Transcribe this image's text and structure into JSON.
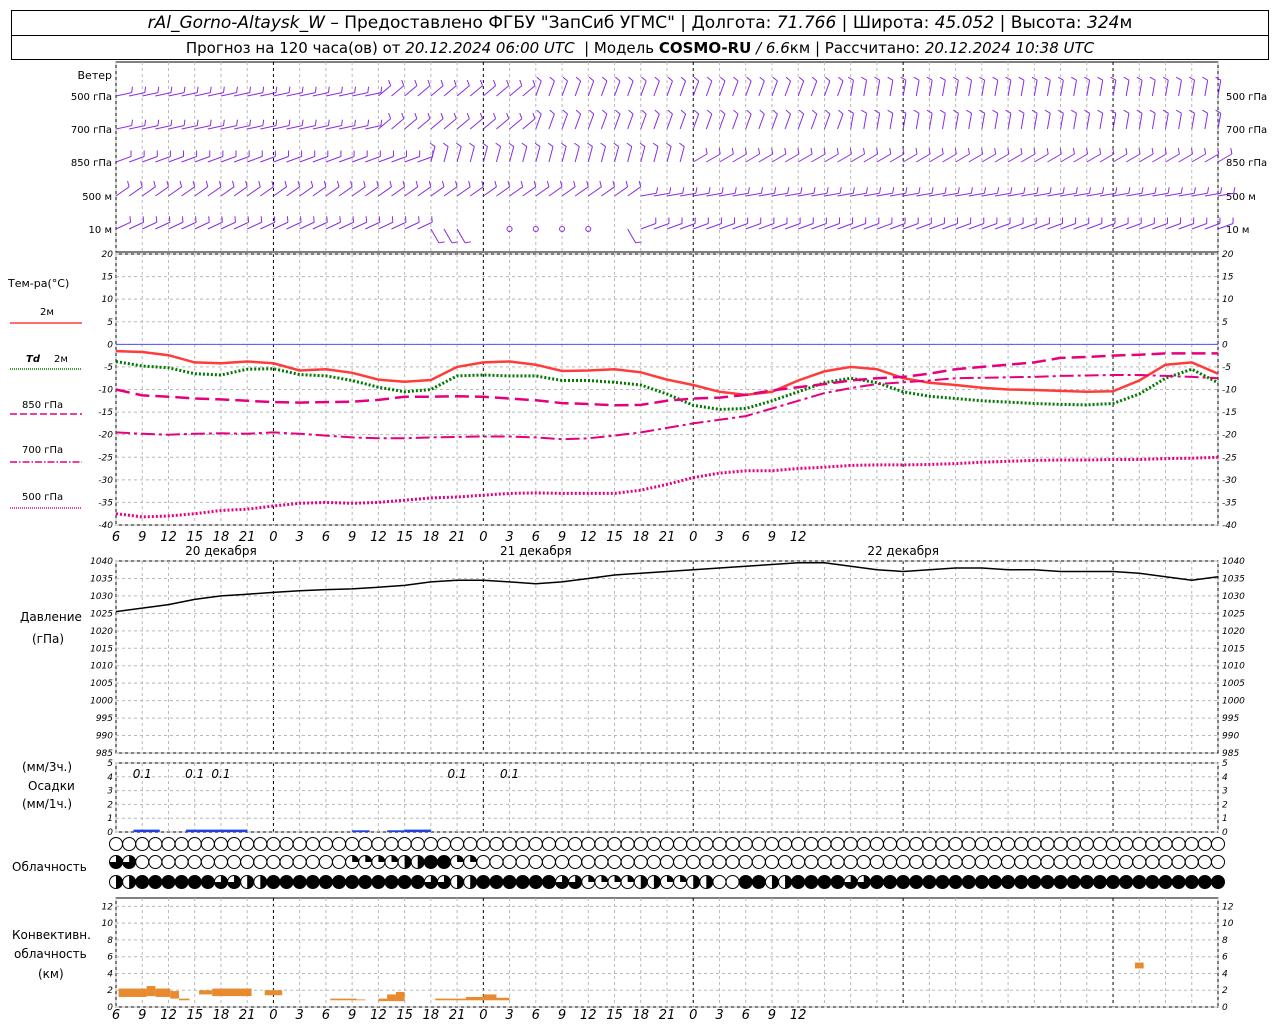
{
  "header": {
    "station": "rAl_Gorno-Altaysk_W",
    "provided_by": "– Предоставлено ФГБУ \"ЗапСиб УГМС\"",
    "lon_label": "Долгота:",
    "lon_value": "71.766",
    "lat_label": "Широта:",
    "lat_value": "45.052",
    "alt_label": "Высота:",
    "alt_value": "324",
    "alt_unit": "м",
    "forecast_prefix": "Прогноз на 120 часа(ов) от",
    "forecast_from": "20.12.2024 06:00 UTC",
    "model_label": "Модель",
    "model_name": "COSMO-RU",
    "model_res": "/ 6.6",
    "model_res_unit": "км",
    "calc_label": "Рассчитано:",
    "calc_time": "20.12.2024 10:38 UTC"
  },
  "time_axis": {
    "hour_labels": [
      "6",
      "9",
      "12",
      "15",
      "18",
      "21",
      "0",
      "3",
      "6",
      "9",
      "12",
      "15",
      "18",
      "21",
      "0",
      "3",
      "6",
      "9",
      "12",
      "15",
      "18",
      "21",
      "0",
      "3",
      "6",
      "9",
      "12"
    ],
    "day_labels": [
      "20 декабря",
      "21 декабря",
      "22 декабря"
    ]
  },
  "colors": {
    "wind": "#8a2be2",
    "t2m": "#ff3b3b",
    "td2m": "#007800",
    "t850": "#e6007e",
    "t700": "#e6007e",
    "t500": "#e6007e",
    "pressure": "#000000",
    "precip": "#2040e0",
    "convective": "#e88a2e",
    "zero_line": "#5050ff"
  },
  "labels": {
    "wind": "Ветер",
    "wind_levels": [
      "500 гПа",
      "700 гПа",
      "850 гПа",
      "500 м",
      "10 м"
    ],
    "temp": "Тем-ра(°C)",
    "t2m": "2м",
    "td_sym": "Td",
    "td_2m": "2м",
    "t850": "850 гПа",
    "t700": "700 гПа",
    "t500": "500 гПа",
    "pressure": "Давление",
    "pressure_unit": "(гПа)",
    "precip_unit3": "(мм/3ч.)",
    "precip": "Осадки",
    "precip_unit1": "(мм/1ч.)",
    "clouds": "Облачность",
    "conv1": "Конвективн.",
    "conv2": "облачность",
    "conv3": "(км)"
  },
  "chart_data": [
    {
      "type": "line",
      "title": "Тем-ра(°C)",
      "ylim": [
        -40,
        20
      ],
      "yticks": [
        20,
        15,
        10,
        5,
        0,
        -5,
        -10,
        -15,
        -20,
        -25,
        -30,
        -35,
        -40
      ],
      "x_hours_since_start": [
        0,
        3,
        6,
        9,
        12,
        15,
        18,
        21,
        24,
        27,
        30,
        33,
        36,
        39,
        42,
        45,
        48,
        51,
        54,
        57,
        60,
        63,
        66,
        69,
        72,
        75,
        78,
        81,
        84,
        87,
        90,
        93,
        96,
        99,
        102,
        105,
        108,
        111,
        114,
        117,
        120,
        123,
        126
      ],
      "series": [
        {
          "name": "2м",
          "style": "solid",
          "values": [
            -1.5,
            -1.7,
            -2.4,
            -4.0,
            -4.2,
            -3.8,
            -4.2,
            -5.8,
            -5.5,
            -6.3,
            -7.8,
            -8.3,
            -7.9,
            -5.0,
            -4.0,
            -3.8,
            -4.5,
            -5.9,
            -5.8,
            -5.5,
            -6.2,
            -7.8,
            -9.0,
            -10.5,
            -11.2,
            -10.5,
            -8.0,
            -6.0,
            -5.0,
            -5.5,
            -7.5,
            -8.5,
            -9.0,
            -9.6,
            -10.0,
            -10.1,
            -10.3,
            -10.5,
            -10.4,
            -8.0,
            -4.5,
            -4.0,
            -6.5
          ]
        },
        {
          "name": "Td 2м",
          "style": "dotted",
          "values": [
            -3.8,
            -4.8,
            -5.2,
            -6.5,
            -6.8,
            -5.5,
            -5.4,
            -6.7,
            -7.0,
            -8.0,
            -9.5,
            -10.5,
            -10.0,
            -7.0,
            -6.8,
            -7.0,
            -7.0,
            -8.0,
            -8.0,
            -8.4,
            -9.0,
            -11.0,
            -13.5,
            -14.4,
            -14.2,
            -12.5,
            -10.5,
            -8.5,
            -7.5,
            -8.5,
            -10.5,
            -11.5,
            -12.0,
            -12.5,
            -12.8,
            -13.1,
            -13.3,
            -13.4,
            -13.1,
            -11.0,
            -7.5,
            -5.5,
            -8.5
          ]
        },
        {
          "name": "850 гПа",
          "style": "dash",
          "values": [
            -10.0,
            -11.3,
            -11.6,
            -12.0,
            -12.2,
            -12.5,
            -12.8,
            -12.9,
            -12.8,
            -12.7,
            -12.3,
            -11.6,
            -11.6,
            -11.5,
            -11.6,
            -12.0,
            -12.4,
            -13.0,
            -13.2,
            -13.5,
            -13.4,
            -12.5,
            -12.0,
            -11.8,
            -11.2,
            -10.2,
            -9.5,
            -8.8,
            -8.0,
            -7.5,
            -7.2,
            -6.5,
            -5.5,
            -5.0,
            -4.5,
            -4.0,
            -3.0,
            -2.8,
            -2.5,
            -2.3,
            -2.0,
            -2.0,
            -2.0
          ]
        },
        {
          "name": "700 гПа",
          "style": "dashdot",
          "values": [
            -19.5,
            -19.8,
            -20.0,
            -19.8,
            -19.7,
            -19.8,
            -19.5,
            -19.8,
            -20.2,
            -20.6,
            -20.8,
            -20.8,
            -20.6,
            -20.5,
            -20.4,
            -20.4,
            -20.6,
            -21.0,
            -20.8,
            -20.2,
            -19.5,
            -18.5,
            -17.5,
            -16.7,
            -15.9,
            -14.2,
            -12.5,
            -10.8,
            -9.7,
            -8.8,
            -8.4,
            -8.0,
            -7.5,
            -7.4,
            -7.3,
            -7.2,
            -7.0,
            -6.9,
            -6.8,
            -6.8,
            -7.0,
            -7.2,
            -7.5
          ]
        },
        {
          "name": "500 гПа",
          "style": "dotted",
          "values": [
            -37.5,
            -38.2,
            -38.0,
            -37.5,
            -36.8,
            -36.5,
            -35.8,
            -35.2,
            -35.0,
            -35.2,
            -35.0,
            -34.5,
            -34.0,
            -33.8,
            -33.4,
            -33.0,
            -32.9,
            -33.0,
            -33.0,
            -33.0,
            -32.3,
            -31.0,
            -29.5,
            -28.5,
            -28.0,
            -28.0,
            -27.5,
            -27.2,
            -26.8,
            -26.7,
            -26.7,
            -26.6,
            -26.4,
            -26.1,
            -25.9,
            -25.7,
            -25.6,
            -25.6,
            -25.5,
            -25.5,
            -25.3,
            -25.2,
            -25.0
          ]
        }
      ]
    },
    {
      "type": "line",
      "title": "Давление (гПа)",
      "ylim": [
        985,
        1040
      ],
      "yticks": [
        1040,
        1035,
        1030,
        1025,
        1020,
        1015,
        1010,
        1005,
        1000,
        995,
        990,
        985
      ],
      "x_hours_since_start": [
        0,
        3,
        6,
        9,
        12,
        15,
        18,
        21,
        24,
        27,
        30,
        33,
        36,
        39,
        42,
        45,
        48,
        51,
        54,
        57,
        60,
        63,
        66,
        69,
        72,
        75,
        78,
        81,
        84,
        87,
        90,
        93,
        96,
        99,
        102,
        105,
        108,
        111,
        114,
        117,
        120,
        123,
        126
      ],
      "series": [
        {
          "name": "Давление",
          "values": [
            1025.5,
            1026.5,
            1027.5,
            1029.0,
            1030.0,
            1030.5,
            1031.0,
            1031.5,
            1031.8,
            1032.0,
            1032.5,
            1033.0,
            1034.0,
            1034.5,
            1034.5,
            1034.0,
            1033.5,
            1034.0,
            1035.0,
            1036.0,
            1036.5,
            1037.0,
            1037.5,
            1038.0,
            1038.5,
            1039.0,
            1039.5,
            1039.5,
            1038.5,
            1037.5,
            1037.0,
            1037.5,
            1038.0,
            1038.0,
            1037.5,
            1037.5,
            1037.0,
            1037.0,
            1037.0,
            1036.5,
            1035.5,
            1034.5,
            1035.5
          ]
        }
      ]
    },
    {
      "type": "bar",
      "title": "Осадки (мм/3ч.) (мм/1ч.)",
      "ylim": [
        0,
        5
      ],
      "yticks": [
        5,
        4,
        3,
        2,
        1,
        0
      ],
      "bars_mm_per_hour": [
        {
          "start_hour": 2,
          "end_hour": 5,
          "value": 0.1
        },
        {
          "start_hour": 8,
          "end_hour": 12,
          "value": 0.1
        },
        {
          "start_hour": 12,
          "end_hour": 15,
          "value": 0.1
        },
        {
          "start_hour": 27,
          "end_hour": 29,
          "value": 0.05
        },
        {
          "start_hour": 31,
          "end_hour": 33,
          "value": 0.05
        },
        {
          "start_hour": 33,
          "end_hour": 36,
          "value": 0.1
        }
      ],
      "labels_mm_per_3h": [
        {
          "hour": 3,
          "text": "0.1"
        },
        {
          "hour": 9,
          "text": "0.1"
        },
        {
          "hour": 12,
          "text": "0.1"
        },
        {
          "hour": 39,
          "text": "0.1"
        },
        {
          "hour": 45,
          "text": "0.1"
        }
      ]
    },
    {
      "type": "table",
      "title": "Облачность",
      "note": "Three rows of cloud cover circles (upper, middle, lower layers), one per hour; values are oktas-like fractions 0..1",
      "x_hours_since_start": "0..126 step 1",
      "rows": {
        "upper_nonzero": [
          {
            "hour": 66,
            "value": 0.5
          }
        ],
        "middle_nonzero": [
          {
            "hour": 0,
            "value": 0.75
          },
          {
            "hour": 9,
            "value": 0.25
          },
          {
            "hour": 10,
            "value": 0.25
          },
          {
            "hour": 11,
            "value": 0.5
          },
          {
            "hour": 12,
            "value": 1
          },
          {
            "hour": 13,
            "value": 0.25
          },
          {
            "hour": 66,
            "value": 0.5
          },
          {
            "hour": 67,
            "value": 0.5
          },
          {
            "hour": 68,
            "value": 0.5
          },
          {
            "hour": 69,
            "value": 0.5
          },
          {
            "hour": 70,
            "value": 0.75
          },
          {
            "hour": 71,
            "value": 0.5
          },
          {
            "hour": 72,
            "value": 0.75
          },
          {
            "hour": 73,
            "value": 0.5
          },
          {
            "hour": 74,
            "value": 0.5
          },
          {
            "hour": 75,
            "value": 0.5
          },
          {
            "hour": 76,
            "value": 0.5
          },
          {
            "hour": 77,
            "value": 0.5
          }
        ],
        "lower_nonzero": [
          {
            "hour": 0,
            "value": 0.5
          },
          {
            "hour": 1,
            "value": 1
          },
          {
            "hour": 2,
            "value": 1
          },
          {
            "hour": 3,
            "value": 1
          },
          {
            "hour": 4,
            "value": 0.75
          },
          {
            "hour": 5,
            "value": 0.5
          },
          {
            "hour": 6,
            "value": 1
          },
          {
            "hour": 7,
            "value": 1
          },
          {
            "hour": 8,
            "value": 1
          },
          {
            "hour": 9,
            "value": 1
          },
          {
            "hour": 10,
            "value": 1
          },
          {
            "hour": 11,
            "value": 1
          },
          {
            "hour": 12,
            "value": 0.75
          },
          {
            "hour": 13,
            "value": 0.5
          },
          {
            "hour": 14,
            "value": 1
          },
          {
            "hour": 15,
            "value": 1
          },
          {
            "hour": 16,
            "value": 1
          },
          {
            "hour": 17,
            "value": 0.75
          },
          {
            "hour": 18,
            "value": 0.25
          },
          {
            "hour": 19,
            "value": 0.25
          },
          {
            "hour": 20,
            "value": 0.5
          },
          {
            "hour": 21,
            "value": 0.25
          },
          {
            "hour": 22,
            "value": 0.5
          },
          {
            "hour": 24,
            "value": 1
          },
          {
            "hour": 25,
            "value": 0.5
          },
          {
            "hour": 26,
            "value": 1
          },
          {
            "hour": 27,
            "value": 1
          },
          {
            "hour": 28,
            "value": 0.75
          },
          {
            "hour": 29,
            "value": 1
          },
          {
            "hour": 30,
            "value": 1
          },
          {
            "hour": 31,
            "value": 1
          },
          {
            "hour": 32,
            "value": 1
          },
          {
            "hour": 33,
            "value": 1
          },
          {
            "hour": 34,
            "value": 1
          },
          {
            "hour": 35,
            "value": 1
          },
          {
            "hour": 36,
            "value": 1
          },
          {
            "hour": 37,
            "value": 1
          },
          {
            "hour": 38,
            "value": 1
          },
          {
            "hour": 39,
            "value": 1
          },
          {
            "hour": 40,
            "value": 1
          },
          {
            "hour": 41,
            "value": 1
          },
          {
            "hour": 42,
            "value": 1
          },
          {
            "hour": 43,
            "value": 1
          },
          {
            "hour": 44,
            "value": 1
          },
          {
            "hour": 45,
            "value": 0.5
          },
          {
            "hour": 46,
            "value": 0.25
          }
        ]
      }
    },
    {
      "type": "bar",
      "title": "Конвективн. облачность (км)",
      "ylim": [
        0,
        13
      ],
      "yticks": [
        12,
        10,
        8,
        6,
        4,
        2,
        0
      ],
      "blocks_km": [
        {
          "start_hour": 0.3,
          "end_hour": 3.5,
          "bottom": 1.2,
          "top": 2.2
        },
        {
          "start_hour": 3.5,
          "end_hour": 4.5,
          "bottom": 1.3,
          "top": 2.5
        },
        {
          "start_hour": 4.5,
          "end_hour": 6.2,
          "bottom": 1.2,
          "top": 2.2
        },
        {
          "start_hour": 6.2,
          "end_hour": 7.2,
          "bottom": 1.0,
          "top": 1.9
        },
        {
          "start_hour": 7.2,
          "end_hour": 8.4,
          "bottom": 0.8,
          "top": 1.0
        },
        {
          "start_hour": 9.5,
          "end_hour": 11.0,
          "bottom": 1.5,
          "top": 2.0
        },
        {
          "start_hour": 11.0,
          "end_hour": 15.5,
          "bottom": 1.3,
          "top": 2.2
        },
        {
          "start_hour": 17.0,
          "end_hour": 19.0,
          "bottom": 1.4,
          "top": 2.0
        },
        {
          "start_hour": 24.5,
          "end_hour": 27.5,
          "bottom": 0.8,
          "top": 1.0
        },
        {
          "start_hour": 27.5,
          "end_hour": 28.5,
          "bottom": 0.8,
          "top": 0.9
        },
        {
          "start_hour": 30.0,
          "end_hour": 31.0,
          "bottom": 0.7,
          "top": 1.0
        },
        {
          "start_hour": 31.0,
          "end_hour": 32.0,
          "bottom": 0.7,
          "top": 1.5
        },
        {
          "start_hour": 32.0,
          "end_hour": 33.0,
          "bottom": 0.7,
          "top": 1.8
        },
        {
          "start_hour": 36.5,
          "end_hour": 40.0,
          "bottom": 0.8,
          "top": 1.0
        },
        {
          "start_hour": 40.0,
          "end_hour": 42.0,
          "bottom": 0.8,
          "top": 1.2
        },
        {
          "start_hour": 42.0,
          "end_hour": 43.5,
          "bottom": 0.8,
          "top": 1.5
        },
        {
          "start_hour": 43.5,
          "end_hour": 45.0,
          "bottom": 0.8,
          "top": 1.1
        },
        {
          "start_hour": 116.5,
          "end_hour": 117.5,
          "bottom": 4.6,
          "top": 5.3
        }
      ]
    }
  ]
}
